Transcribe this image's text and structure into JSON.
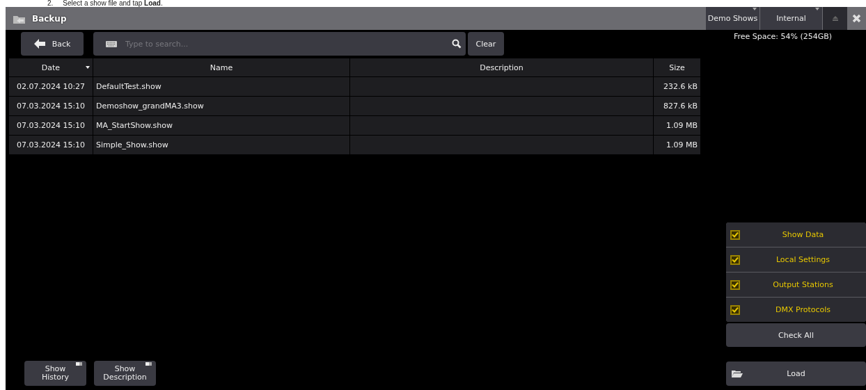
{
  "instruction": {
    "number": "2.",
    "text": "Select a show file and tap **Load**."
  },
  "window": {
    "title": "Backup",
    "drives": [
      {
        "label": "Demo Shows"
      },
      {
        "label": "Internal"
      }
    ]
  },
  "toolbar": {
    "back": "Back",
    "search": {
      "placeholder": "Type to search..."
    },
    "clear": "Clear"
  },
  "free_space": "Free Space: 54% (254GB)",
  "table": {
    "columns": [
      {
        "label": "Date",
        "sorted": true
      },
      {
        "label": "Name",
        "sorted": false
      },
      {
        "label": "Description",
        "sorted": false
      },
      {
        "label": "Size",
        "sorted": false
      }
    ],
    "rows": [
      [
        "02.07.2024 10:27",
        "DefaultTest.show",
        "",
        "232.6 kB"
      ],
      [
        "07.03.2024 15:10",
        "Demoshow_grandMA3.show",
        "",
        "827.6 kB"
      ],
      [
        "07.03.2024 15:10",
        "MA_StartShow.show",
        "",
        "1.09 MB"
      ],
      [
        "07.03.2024 15:10",
        "Simple_Show.show",
        "",
        "1.09 MB"
      ]
    ]
  },
  "options": [
    {
      "label": "Show Data",
      "checked": true
    },
    {
      "label": "Local Settings",
      "checked": true
    },
    {
      "label": "Output Stations",
      "checked": true
    },
    {
      "label": "DMX Protocols",
      "checked": true
    }
  ],
  "check_all": "Check All",
  "load": "Load",
  "bottom_buttons": [
    {
      "top": "Show",
      "bottom": "History",
      "on": false
    },
    {
      "top": "Show",
      "bottom": "Description",
      "on": false
    }
  ]
}
